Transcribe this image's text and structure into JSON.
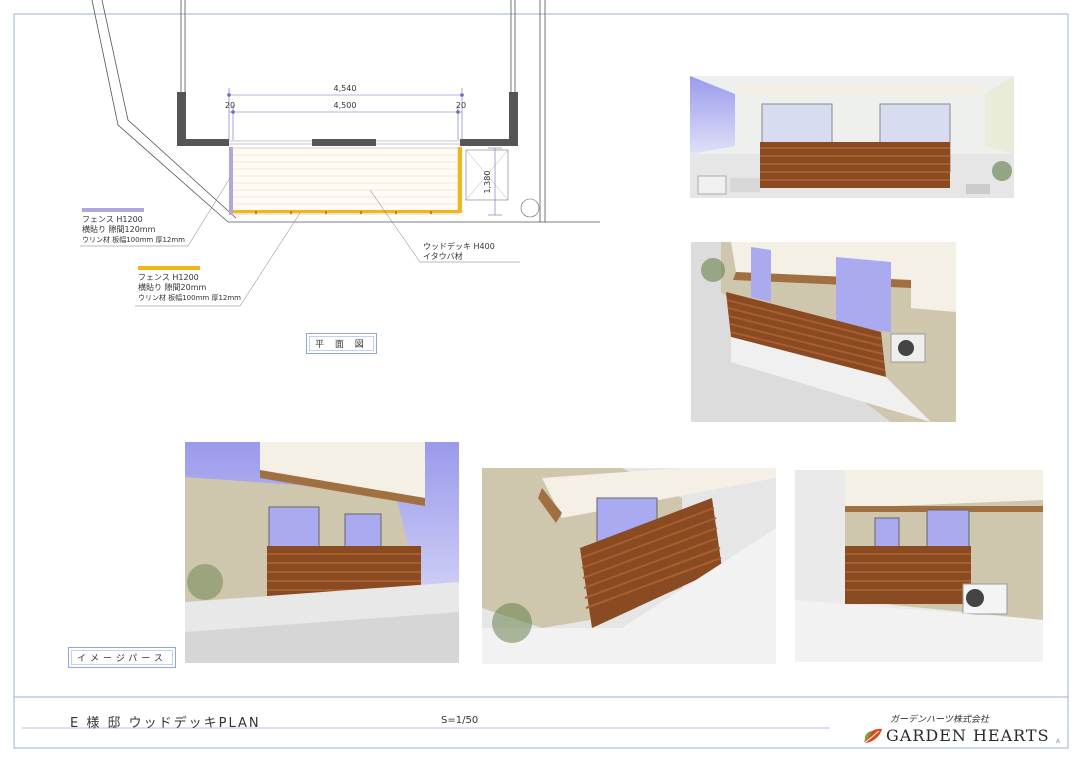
{
  "plan": {
    "dim_total": "4,540",
    "dim_inner": "4,500",
    "dim_left": "20",
    "dim_right": "20",
    "dim_depth": "1,380",
    "deck_label": [
      "ウッドデッキ H400",
      "イタウバ材"
    ],
    "view_label": "平 面 図"
  },
  "legend": [
    {
      "color": "#b3a6dc",
      "lines": [
        "フェンス H1200",
        "横貼り 隙間120mm",
        "ウリン材 板幅100mm 厚12mm"
      ]
    },
    {
      "color": "#f2b619",
      "lines": [
        "フェンス H1200",
        "横貼り 隙間20mm",
        "ウリン材 板幅100mm 厚12mm"
      ]
    }
  ],
  "image_section_label": "イメージパース",
  "title_block": {
    "title": "E 様 邸 ウッドデッキPLAN",
    "scale": "S=1/50",
    "company_jp": "ガーデンハーツ株式会社",
    "company_en": "GARDEN HEARTS",
    "sheet_mark": "A"
  },
  "colors": {
    "frame": "#9bb0d8",
    "wood": "#8a4a22",
    "wood_light": "#a85f2e",
    "fence_purple": "#b3a6dc",
    "fence_yellow": "#f2b619",
    "brick": "#cfc6ae",
    "sky": "#aaaaf0",
    "wall": "#555555"
  }
}
